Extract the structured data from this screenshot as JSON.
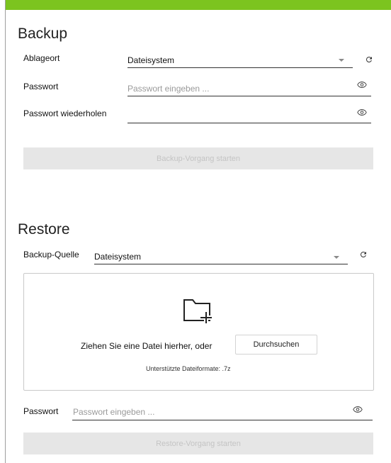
{
  "backup": {
    "title": "Backup",
    "location_label": "Ablageort",
    "location_value": "Dateisystem",
    "password_label": "Passwort",
    "password_placeholder": "Passwort eingeben ...",
    "password_repeat_label": "Passwort wiederholen",
    "password_repeat_value": "",
    "start_button": "Backup-Vorgang starten"
  },
  "restore": {
    "title": "Restore",
    "source_label": "Backup-Quelle",
    "source_value": "Dateisystem",
    "drop_text": "Ziehen Sie eine Datei hierher, oder",
    "browse_button": "Durchsuchen",
    "formats_text": "Unterstützte Dateiformate: .7z",
    "password_label": "Passwort",
    "password_placeholder": "Passwort eingeben ...",
    "start_button": "Restore-Vorgang starten"
  },
  "icons": {
    "refresh": "refresh-icon",
    "visibility": "eye-icon",
    "dropdown": "chevron-down-icon",
    "folder_add": "folder-add-icon"
  },
  "colors": {
    "accent": "#7cc41f",
    "disabled_bg": "#e6e6e6",
    "disabled_text": "#c4c4c4"
  }
}
